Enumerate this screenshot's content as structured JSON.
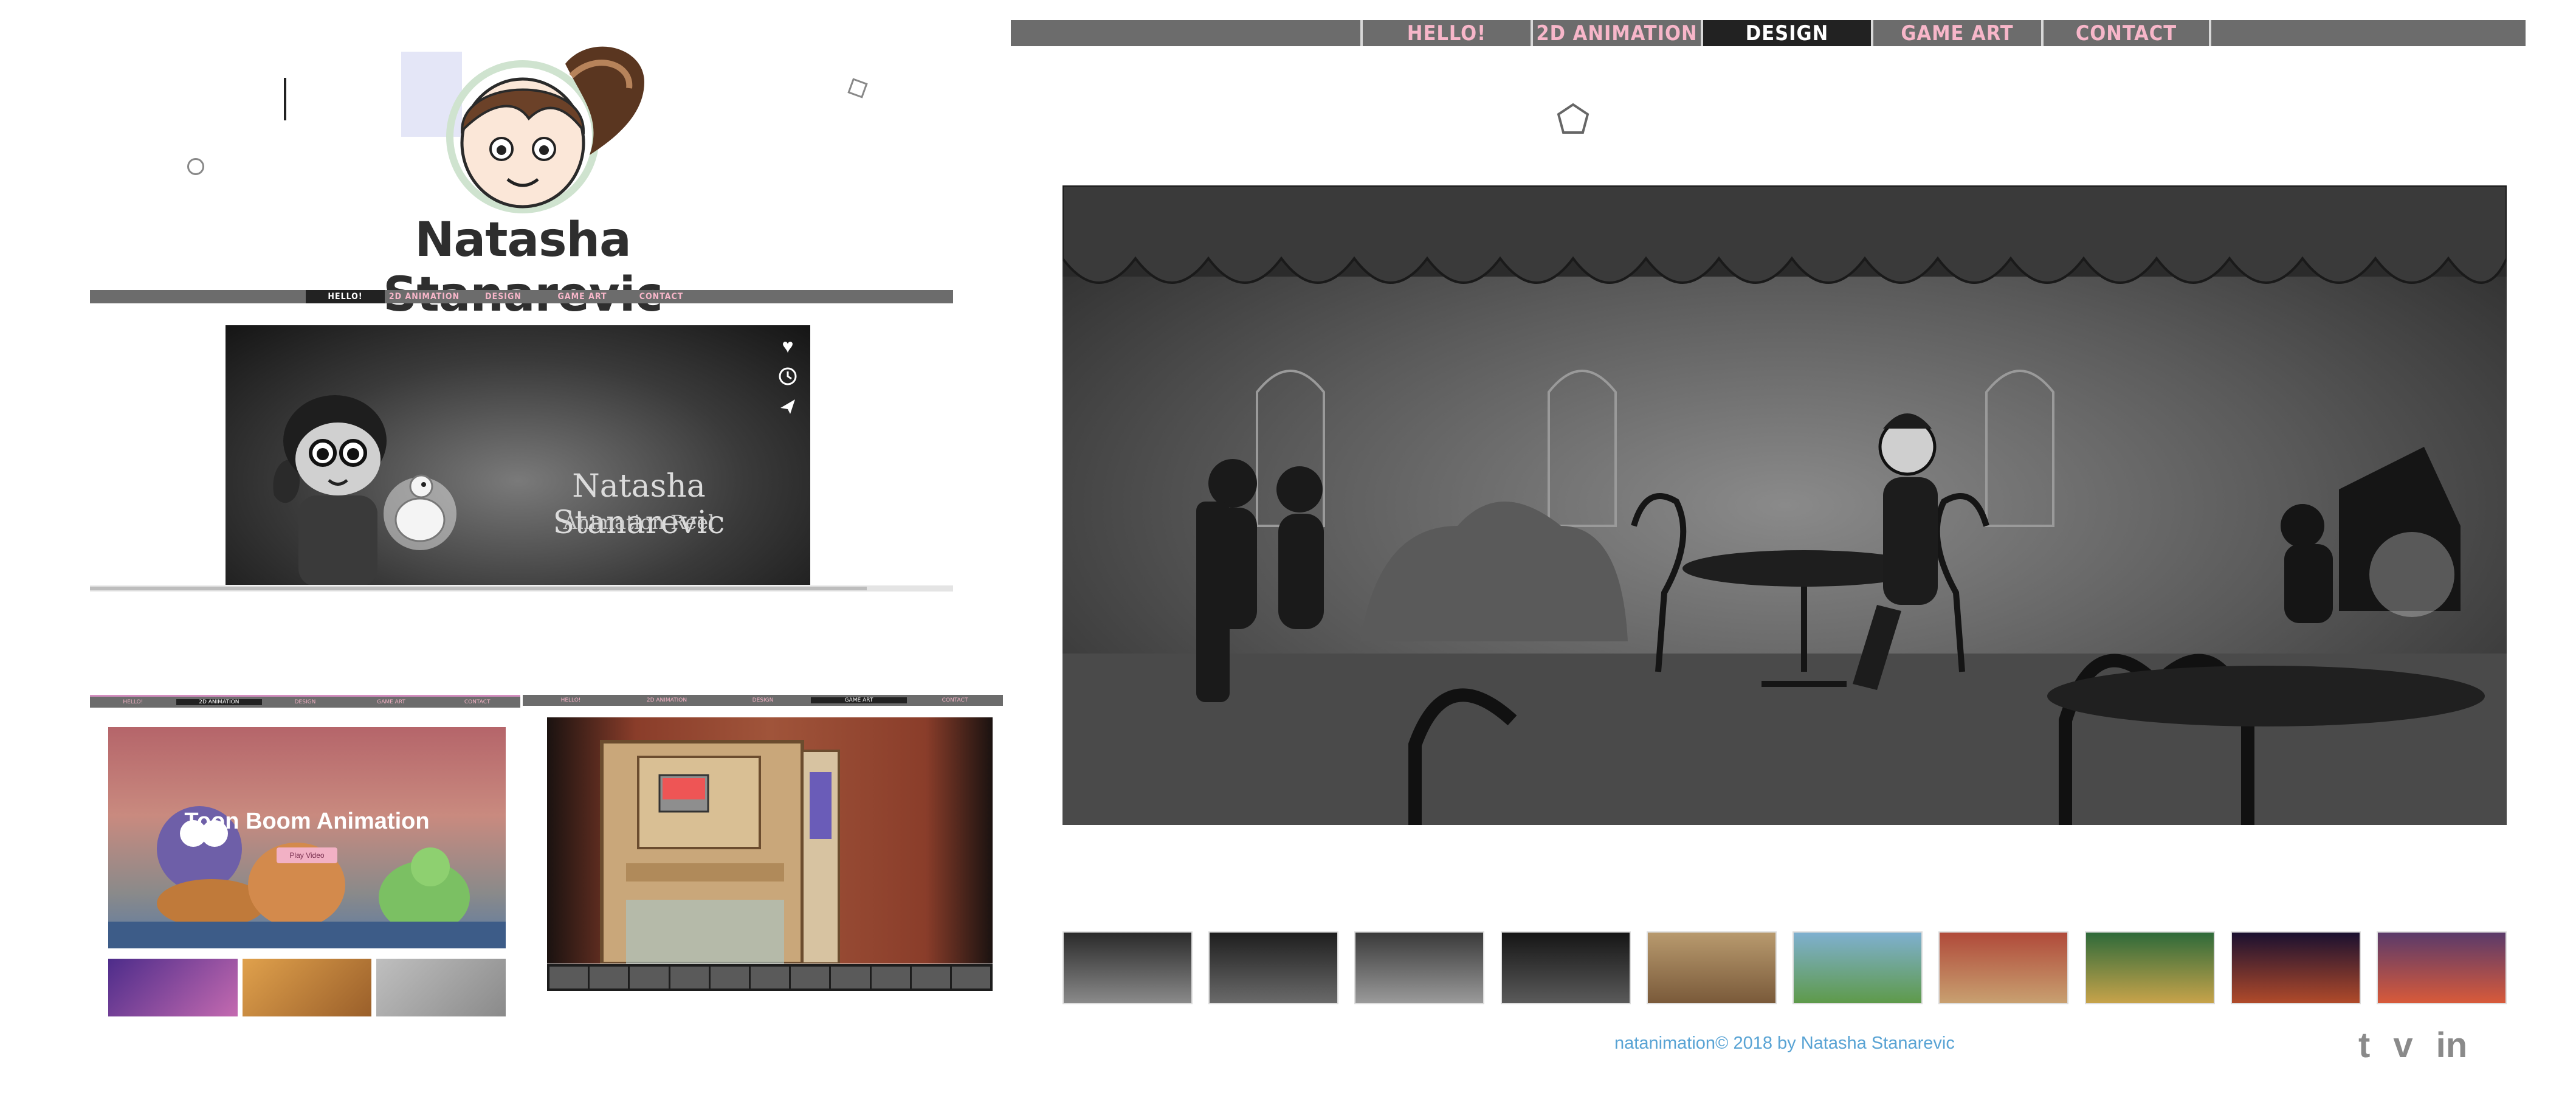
{
  "site": {
    "name": "Natasha Stanarevic"
  },
  "main_nav": {
    "items": [
      {
        "label": "HELLO!",
        "active": false
      },
      {
        "label": "2D ANIMATION",
        "active": false
      },
      {
        "label": "DESIGN",
        "active": true
      },
      {
        "label": "GAME ART",
        "active": false
      },
      {
        "label": "CONTACT",
        "active": false
      }
    ]
  },
  "left_nav": {
    "items": [
      {
        "label": "HELLO!",
        "active": true
      },
      {
        "label": "2D ANIMATION",
        "active": false
      },
      {
        "label": "DESIGN",
        "active": false
      },
      {
        "label": "GAME ART",
        "active": false
      },
      {
        "label": "CONTACT",
        "active": false
      }
    ]
  },
  "reel": {
    "title": "Natasha Stanarevic",
    "subtitle": "Animation Reel",
    "progress": 0.9
  },
  "toon_preview": {
    "title": "Toon Boom Animation",
    "play_label": "Play Video"
  },
  "footer": {
    "text": "natanimation© 2018 by Natasha Stanarevic"
  },
  "social": {
    "tumblr": "t",
    "vimeo": "v",
    "linkedin": "in"
  },
  "icons": [
    "heart-icon",
    "clock-icon",
    "send-icon",
    "tumblr-icon",
    "vimeo-icon",
    "linkedin-icon"
  ],
  "colors": {
    "nav_bg": "#6c6c6c",
    "nav_active": "#222222",
    "nav_text": "#f7b6c9",
    "footer_link": "#58a3d4"
  }
}
